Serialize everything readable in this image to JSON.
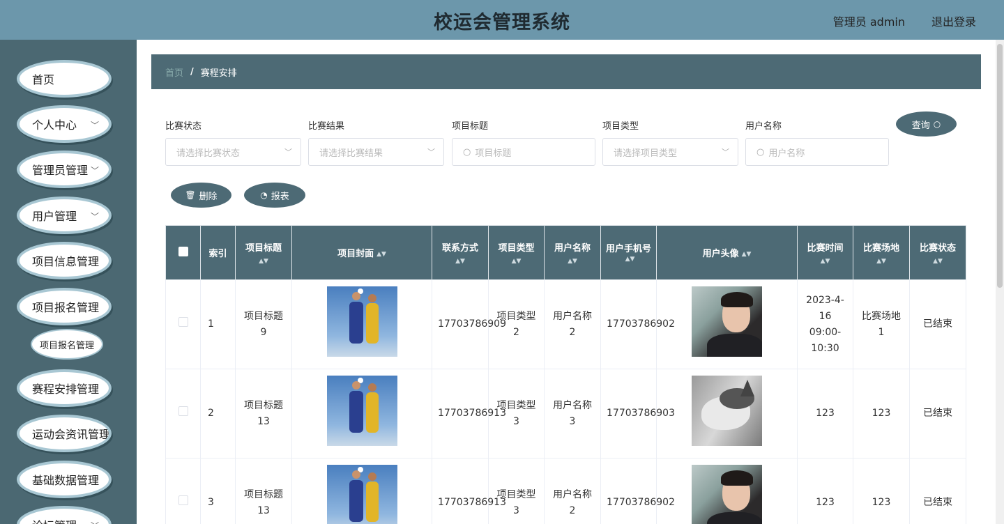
{
  "header": {
    "title": "校运会管理系统",
    "user": "管理员 admin",
    "logout": "退出登录"
  },
  "sidebar": {
    "items": [
      {
        "label": "首页",
        "chevron": false
      },
      {
        "label": "个人中心",
        "chevron": true
      },
      {
        "label": "管理员管理",
        "chevron": true
      },
      {
        "label": "用户管理",
        "chevron": true
      },
      {
        "label": "项目信息管理",
        "chevron": true
      },
      {
        "label": "项目报名管理",
        "chevron": true
      },
      {
        "label": "赛程安排管理",
        "chevron": true
      },
      {
        "label": "运动会资讯管理",
        "chevron": true
      },
      {
        "label": "基础数据管理",
        "chevron": true
      },
      {
        "label": "论坛管理",
        "chevron": true
      }
    ],
    "subitem": "项目报名管理"
  },
  "breadcrumb": {
    "home": "首页",
    "separator": "/",
    "current": "赛程安排"
  },
  "filters": {
    "status_label": "比赛状态",
    "status_placeholder": "请选择比赛状态",
    "result_label": "比赛结果",
    "result_placeholder": "请选择比赛结果",
    "title_label": "项目标题",
    "title_placeholder": "项目标题",
    "type_label": "项目类型",
    "type_placeholder": "请选择项目类型",
    "username_label": "用户名称",
    "username_placeholder": "用户名称",
    "query_button": "查询"
  },
  "actions": {
    "delete": "删除",
    "report": "报表"
  },
  "table": {
    "headers": [
      "索引",
      "项目标题",
      "项目封面",
      "联系方式",
      "项目类型",
      "用户名称",
      "用户手机号",
      "用户头像",
      "比赛时间",
      "比赛场地",
      "比赛状态"
    ],
    "rows": [
      {
        "index": "1",
        "title": "项目标题9",
        "cover": "football-photo",
        "contact": "17703786909",
        "type": "项目类型2",
        "username": "用户名称2",
        "phone": "17703786902",
        "avatar": "man-photo",
        "time": "2023-4-16 09:00-10:30",
        "venue": "比赛场地1",
        "status": "已结束"
      },
      {
        "index": "2",
        "title": "项目标题13",
        "cover": "football-photo",
        "contact": "17703786913",
        "type": "项目类型3",
        "username": "用户名称3",
        "phone": "17703786903",
        "avatar": "dog-photo",
        "time": "123",
        "venue": "123",
        "status": "已结束"
      },
      {
        "index": "3",
        "title": "项目标题13",
        "cover": "football-photo",
        "contact": "17703786913",
        "type": "项目类型3",
        "username": "用户名称2",
        "phone": "17703786902",
        "avatar": "man-photo",
        "time": "123",
        "venue": "123",
        "status": "已结束"
      }
    ]
  },
  "colors": {
    "header_bg": "#6c97ab",
    "sidebar_bg": "#4b6872",
    "accent": "#4d6a75"
  }
}
